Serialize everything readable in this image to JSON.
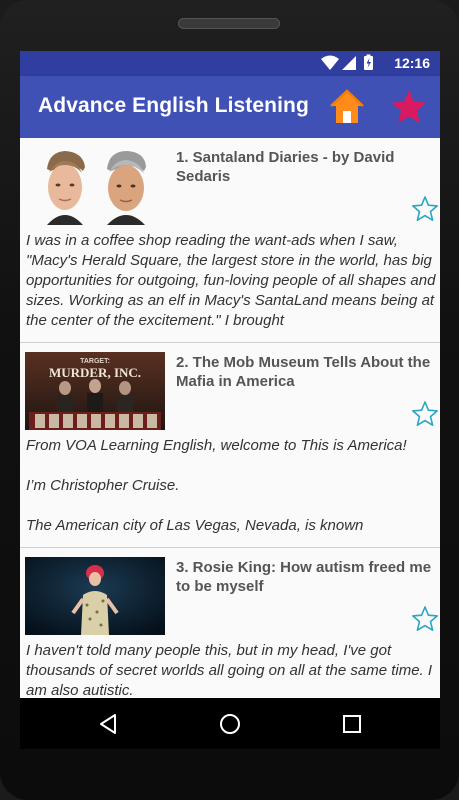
{
  "status": {
    "time": "12:16",
    "icons": [
      "wifi-icon",
      "signal-icon",
      "battery-icon"
    ]
  },
  "app": {
    "title": "Advance English Listening",
    "home_icon": "home-icon",
    "favorites_icon": "star-icon",
    "colors": {
      "primary": "#3f51b5",
      "primary_dark": "#303f9f",
      "home": "#ff8c1a",
      "star": "#d81b60",
      "fav_outline": "#2aa6c4"
    }
  },
  "items": [
    {
      "title": "1. Santaland Diaries - by David Sedaris",
      "excerpt": "I was in a coffee shop reading the want-ads when I saw, \"Macy's Herald Square, the largest store in the world, has big opportunities for outgoing, fun-loving people of all shapes and sizes. Working as an elf in Macy's SantaLand means being at the center of the excitement.\" I brought",
      "thumb": "two-faces-photo"
    },
    {
      "title": "2. The Mob Museum Tells About the Mafia in America",
      "excerpt": "From VOA Learning English, welcome to This is America!\n\nI’m Christopher Cruise.\n\nThe American city of Las Vegas, Nevada, is known",
      "thumb": "mob-museum-photo",
      "thumb_text": [
        "TARGET:",
        "MURDER, INC."
      ]
    },
    {
      "title": "3. Rosie King: How autism freed me to be myself",
      "excerpt": "I haven't told many people this, but in my head, I've got thousands of secret worlds all going on all at the same time. I am also autistic.",
      "thumb": "speaker-on-stage-photo"
    }
  ],
  "nav": [
    "back-icon",
    "home-circle-icon",
    "recents-icon"
  ]
}
